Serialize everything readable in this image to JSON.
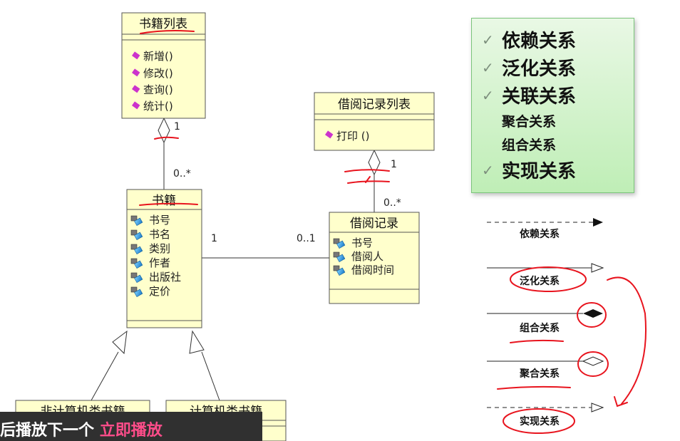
{
  "classes": {
    "book_list": {
      "name": "书籍列表",
      "ops": [
        "新增()",
        "修改()",
        "查询()",
        "统计()"
      ]
    },
    "book": {
      "name": "书籍",
      "attrs": [
        "书号",
        "书名",
        "类别",
        "作者",
        "出版社",
        "定价"
      ]
    },
    "borrow_list": {
      "name": "借阅记录列表",
      "ops": [
        "打印 ()"
      ]
    },
    "borrow": {
      "name": "借阅记录",
      "attrs": [
        "书号",
        "借阅人",
        "借阅时间"
      ]
    },
    "non_cs_book": {
      "name": "非计算机类书籍"
    },
    "cs_book": {
      "name": "计算机类书籍"
    }
  },
  "multiplicities": {
    "list_book_top": "1",
    "list_book_bottom": "0..*",
    "book_borrow_left": "1",
    "book_borrow_right": "0..1",
    "borrowlist_top": "1",
    "borrowlist_bottom": "0..*"
  },
  "relations_box": {
    "items": [
      {
        "label": "依赖关系",
        "checked": true,
        "size": "large"
      },
      {
        "label": "泛化关系",
        "checked": true,
        "size": "large"
      },
      {
        "label": "关联关系",
        "checked": true,
        "size": "large"
      },
      {
        "label": "聚合关系",
        "checked": false,
        "size": "small"
      },
      {
        "label": "组合关系",
        "checked": false,
        "size": "small"
      },
      {
        "label": "实现关系",
        "checked": true,
        "size": "large"
      }
    ],
    "check_glyph": "✓"
  },
  "legend": {
    "dependency": "依赖关系",
    "generalization": "泛化关系",
    "composition": "组合关系",
    "aggregation": "聚合关系",
    "realization": "实现关系"
  },
  "overlay": {
    "prefix": "后播放下一个",
    "action": "立即播放"
  },
  "colors": {
    "class_fill": "#ffffcc",
    "annotation": "#e8141e",
    "op_icon": "#cc33cc",
    "attr_icon": "#2aa0e0",
    "green_border": "#7bc47b"
  }
}
